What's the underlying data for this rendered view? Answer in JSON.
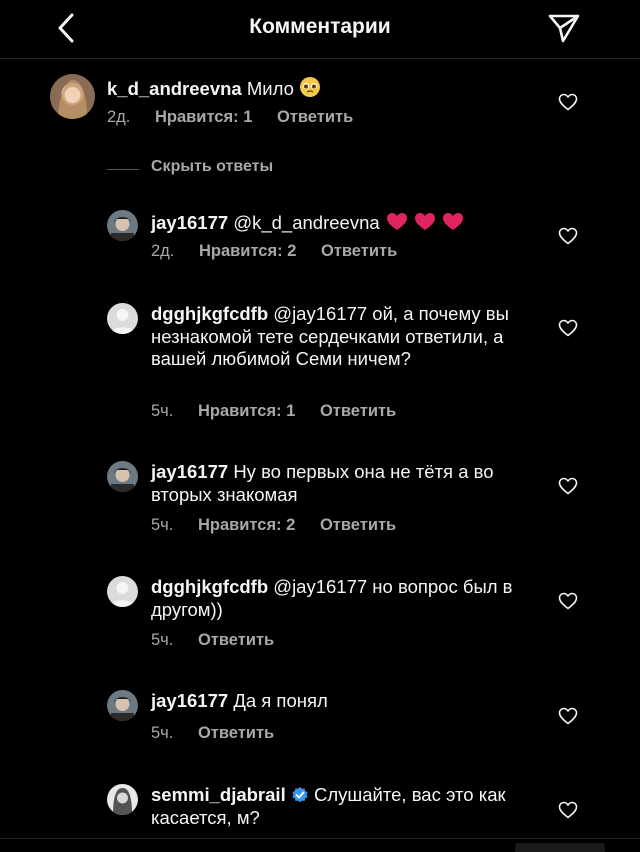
{
  "header": {
    "title": "Комментарии"
  },
  "main_comment": {
    "username": "k_d_andreevna",
    "text": "Мило",
    "emoji": "pleading-face-icon",
    "time": "2д.",
    "likes": "Нравится: 1",
    "reply": "Ответить"
  },
  "hide_replies": "Скрыть ответы",
  "replies": [
    {
      "username": "jay16177",
      "text": "@k_d_andreevna",
      "emoji": "red-hearts-icon",
      "time": "2д.",
      "likes": "Нравится: 2",
      "reply": "Ответить"
    },
    {
      "username": "dgghjkgfcdfb",
      "text": "@jay16177 ой, а почему вы незнакомой тете сердечками ответили, а вашей любимой Семи ничем?",
      "time": "5ч.",
      "likes": "Нравится: 1",
      "reply": "Ответить"
    },
    {
      "username": "jay16177",
      "text": "Ну во первых она не тётя а во вторых знакомая",
      "time": "5ч.",
      "likes": "Нравится: 2",
      "reply": "Ответить"
    },
    {
      "username": "dgghjkgfcdfb",
      "text": "@jay16177 но вопрос был в другом))",
      "time": "5ч.",
      "reply": "Ответить"
    },
    {
      "username": "jay16177",
      "text": "Да я понял",
      "time": "5ч.",
      "reply": "Ответить"
    },
    {
      "username": "semmi_djabrail",
      "verified": true,
      "text": "Слушайте, вас это как касается, м?"
    }
  ],
  "colors": {
    "background": "#000000",
    "text": "#f5f5f5",
    "secondary": "#a8a8a8",
    "verified": "#3897f0",
    "heart_emoji": "#e0245e"
  }
}
